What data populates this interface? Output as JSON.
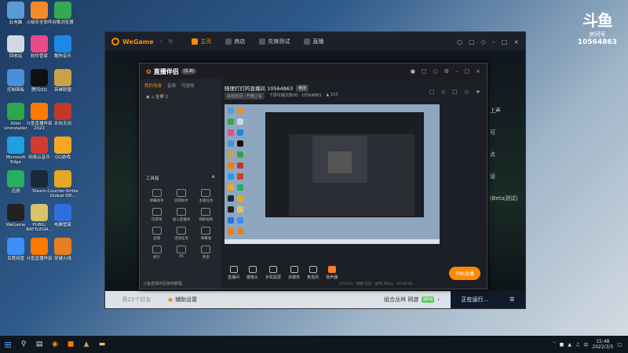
{
  "desktop": {
    "icons": [
      {
        "label": "此电脑",
        "icon": "computer-icon",
        "color": "#5b9bd5"
      },
      {
        "label": "火绒安全软件",
        "icon": "shield-fire-icon",
        "color": "#f28c28"
      },
      {
        "label": "谷歌浏览器",
        "icon": "chrome-icon",
        "color": "#34a853"
      },
      {
        "label": "回收站",
        "icon": "recycle-bin-icon",
        "color": "#cfd8e3"
      },
      {
        "label": "软件管家",
        "icon": "software-manager-icon",
        "color": "#e94b8a"
      },
      {
        "label": "酷狗音乐",
        "icon": "kugou-icon",
        "color": "#1e88e5"
      },
      {
        "label": "控制面板",
        "icon": "control-panel-icon",
        "color": "#4a90d9"
      },
      {
        "label": "腾讯QQ",
        "icon": "qq-icon",
        "color": "#111111"
      },
      {
        "label": "英雄联盟",
        "icon": "lol-icon",
        "color": "#c8a24a"
      },
      {
        "label": "IObit Uninstaller",
        "icon": "uninstaller-icon",
        "color": "#2aa84a"
      },
      {
        "label": "斗鱼直播伴侣 2022",
        "icon": "douyu-companion-icon",
        "color": "#ff7a00"
      },
      {
        "label": "永劫无间",
        "icon": "naraka-icon",
        "color": "#c0392b"
      },
      {
        "label": "Microsoft Edge",
        "icon": "edge-icon",
        "color": "#1fa0e0"
      },
      {
        "label": "网易云音乐",
        "icon": "netease-music-icon",
        "color": "#d33a31"
      },
      {
        "label": "QQ游戏",
        "icon": "qq-game-icon",
        "color": "#f5a623"
      },
      {
        "label": "迅游",
        "icon": "xunyou-icon",
        "color": "#27ae60"
      },
      {
        "label": "Steam",
        "icon": "steam-icon",
        "color": "#1b2838"
      },
      {
        "label": "Counter-Strike Global Off...",
        "icon": "csgo-icon",
        "color": "#e5a823"
      },
      {
        "label": "WeGame",
        "icon": "wegame-icon",
        "color": "#222222"
      },
      {
        "label": "PUBG: BATTLEGR...",
        "icon": "pubg-icon",
        "color": "#d9c36b"
      },
      {
        "label": "电脑管家",
        "icon": "pc-manager-icon",
        "color": "#2f6fdd"
      },
      {
        "label": "百度网盘",
        "icon": "baidu-netdisk-icon",
        "color": "#3e8ef7"
      },
      {
        "label": "斗鱼直播伴侣",
        "icon": "douyu-companion-icon",
        "color": "#ff7a00"
      },
      {
        "label": "穿越火线",
        "icon": "crossfire-icon",
        "color": "#e67e22"
      }
    ]
  },
  "douyu_badge": {
    "logo": "斗鱼",
    "sub": "房间号",
    "room": "10564863"
  },
  "wegame": {
    "logo": "WeGame",
    "tabs": [
      {
        "label": "主页",
        "icon": "home-icon",
        "active": true
      },
      {
        "label": "商店",
        "icon": "store-icon",
        "active": false
      },
      {
        "label": "先锋测试",
        "icon": "test-icon",
        "active": false
      },
      {
        "label": "直播",
        "icon": "live-icon",
        "active": false
      }
    ],
    "bottom": {
      "left": "英22个好友",
      "assist": "辅助设置",
      "game": "组合丛林 网遊",
      "game_tag": "NEW",
      "running": "正在运行..."
    },
    "side_snippets": [
      "上声",
      "可",
      "点",
      "设",
      "(Beta测试)"
    ]
  },
  "companion": {
    "brand": "直播伴侣",
    "version_pill": "(5.0)",
    "left_tabs": [
      {
        "label": "我的场景",
        "active": true
      },
      {
        "label": "音频",
        "active": false
      },
      {
        "label": "可逆效",
        "active": false
      }
    ],
    "scene": "全屏 1",
    "tools_title": "工具箱",
    "tools": [
      {
        "label": "弹幕助手",
        "icon": "danmu-icon"
      },
      {
        "label": "房管助手",
        "icon": "admin-icon"
      },
      {
        "label": "主播任务",
        "icon": "task-icon"
      },
      {
        "label": "玩游戏",
        "icon": "game-icon"
      },
      {
        "label": "送入直播间",
        "icon": "send-icon"
      },
      {
        "label": "领取福利",
        "icon": "gift-icon"
      },
      {
        "label": "滤镜",
        "icon": "filter-icon"
      },
      {
        "label": "活动任务",
        "icon": "activity-icon"
      },
      {
        "label": "弹幕墙",
        "icon": "wall-icon"
      },
      {
        "label": "统计",
        "icon": "stats-icon"
      },
      {
        "label": "PK",
        "icon": "pk-icon"
      },
      {
        "label": "更多",
        "icon": "more-icon"
      }
    ],
    "left_footer": "斗鱼直播伴侣使用教程",
    "stream_title": "随便打打的直播间 10564863",
    "edit_label": "修改",
    "category": "永劫无间 · 开播上车",
    "viewers": "下周可播次数00 · 10564863",
    "hotness": "153",
    "bottom_buttons": [
      {
        "label": "直播间",
        "icon": "room-icon",
        "accent": false
      },
      {
        "label": "摄像头",
        "icon": "camera-icon",
        "accent": false
      },
      {
        "label": "手机投屏",
        "icon": "phone-cast-icon",
        "accent": false
      },
      {
        "label": "多媒体",
        "icon": "media-icon",
        "accent": false
      },
      {
        "label": "麦克风",
        "icon": "microphone-icon",
        "accent": false
      },
      {
        "label": "扬声器",
        "icon": "speaker-icon",
        "accent": true
      }
    ],
    "go_live": "开始直播",
    "status": "CPU:2% · 网络:良好 · 帧率:30fps · 00:00:00"
  },
  "taskbar": {
    "time": "15:48",
    "date": "2022/3/5"
  }
}
